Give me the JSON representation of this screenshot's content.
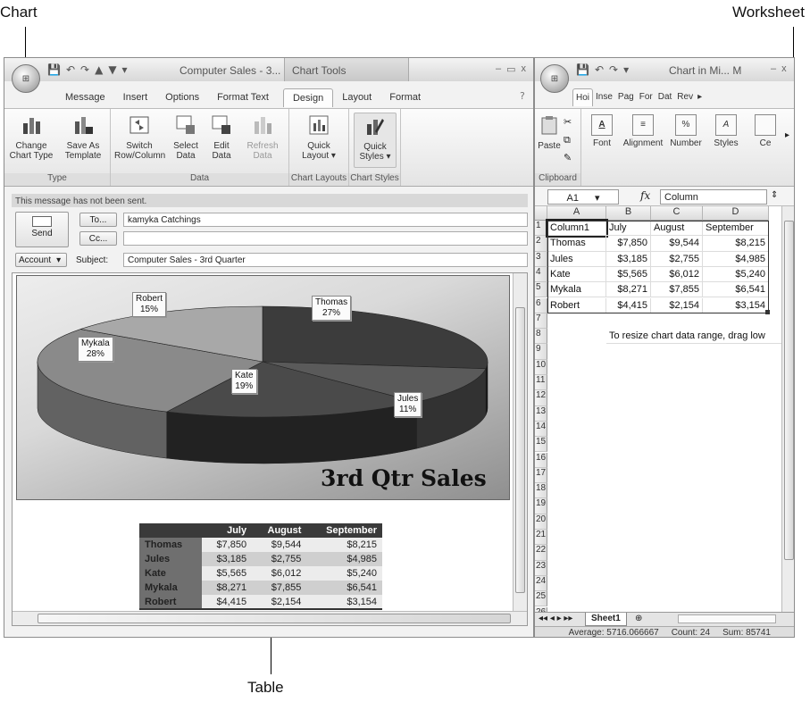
{
  "callouts": {
    "chart": "Chart",
    "worksheet": "Worksheet",
    "table": "Table"
  },
  "outlook": {
    "title": "Computer Sales - 3...",
    "tools_title": "Chart Tools",
    "tabs": [
      "Message",
      "Insert",
      "Options",
      "Format Text",
      "Design",
      "Layout",
      "Format"
    ],
    "active_tab": "Design",
    "ribbon": {
      "type_group": {
        "label": "Type",
        "change_chart_type": "Change\nChart Type",
        "save_as_template": "Save As\nTemplate"
      },
      "data_group": {
        "label": "Data",
        "switch": "Switch\nRow/Column",
        "select": "Select\nData",
        "edit": "Edit\nData",
        "refresh": "Refresh\nData"
      },
      "layouts_group": {
        "label": "Chart Layouts",
        "quick_layout": "Quick\nLayout ▾"
      },
      "styles_group": {
        "label": "Chart Styles",
        "quick_styles": "Quick\nStyles ▾"
      }
    },
    "info": "This message has not been sent.",
    "send": "Send",
    "to_button": "To...",
    "cc_button": "Cc...",
    "to_value": "kamyka Catchings",
    "cc_value": "",
    "account_button": "Account",
    "subject_label": "Subject:",
    "subject_value": "Computer Sales - 3rd Quarter"
  },
  "chart_data": {
    "type": "pie",
    "title": "3rd Qtr Sales",
    "slices": [
      {
        "name": "Thomas",
        "percent": 27,
        "label": "27%",
        "color": "#3c3c3c"
      },
      {
        "name": "Jules",
        "percent": 11,
        "label": "11%",
        "color": "#5a5a5a"
      },
      {
        "name": "Kate",
        "percent": 19,
        "label": "19%",
        "color": "#4a4a4a"
      },
      {
        "name": "Mykala",
        "percent": 28,
        "label": "28%",
        "color": "#8a8a8a"
      },
      {
        "name": "Robert",
        "percent": 15,
        "label": "15%",
        "color": "#a8a8a8"
      }
    ]
  },
  "doc_table": {
    "headers": [
      "",
      "July",
      "August",
      "September"
    ],
    "rows": [
      [
        "Thomas",
        "$7,850",
        "$9,544",
        "$8,215"
      ],
      [
        "Jules",
        "$3,185",
        "$2,755",
        "$4,985"
      ],
      [
        "Kate",
        "$5,565",
        "$6,012",
        "$5,240"
      ],
      [
        "Mykala",
        "$8,271",
        "$7,855",
        "$6,541"
      ],
      [
        "Robert",
        "$4,415",
        "$2,154",
        "$3,154"
      ]
    ]
  },
  "excel": {
    "title": "Chart in Mi... M",
    "tabs": [
      "Hoi",
      "Inse",
      "Pag",
      "For",
      "Dat",
      "Rev"
    ],
    "ribbon": {
      "paste": "Paste",
      "font": "Font",
      "alignment": "Alignment",
      "number": "Number",
      "styles": "Styles",
      "cells": "Ce",
      "clipboard": "Clipboard"
    },
    "namebox": "A1",
    "fx": "fx",
    "formula_value": "Column",
    "columns": [
      "A",
      "B",
      "C",
      "D"
    ],
    "rows": [
      [
        "Column1",
        "July",
        "August",
        "September"
      ],
      [
        "Thomas",
        "$7,850",
        "$9,544",
        "$8,215"
      ],
      [
        "Jules",
        "$3,185",
        "$2,755",
        "$4,985"
      ],
      [
        "Kate",
        "$5,565",
        "$6,012",
        "$5,240"
      ],
      [
        "Mykala",
        "$8,271",
        "$7,855",
        "$6,541"
      ],
      [
        "Robert",
        "$4,415",
        "$2,154",
        "$3,154"
      ]
    ],
    "note": "To resize chart data range, drag low",
    "row_numbers": [
      "1",
      "2",
      "3",
      "4",
      "5",
      "6",
      "7",
      "8",
      "9",
      "10",
      "11",
      "12",
      "13",
      "14",
      "15",
      "16",
      "17",
      "18",
      "19",
      "20",
      "21",
      "22",
      "23",
      "24",
      "25",
      "26"
    ],
    "sheet_tab": "Sheet1",
    "status": {
      "average": "Average: 5716.066667",
      "count": "Count: 24",
      "sum": "Sum: 85741"
    }
  }
}
